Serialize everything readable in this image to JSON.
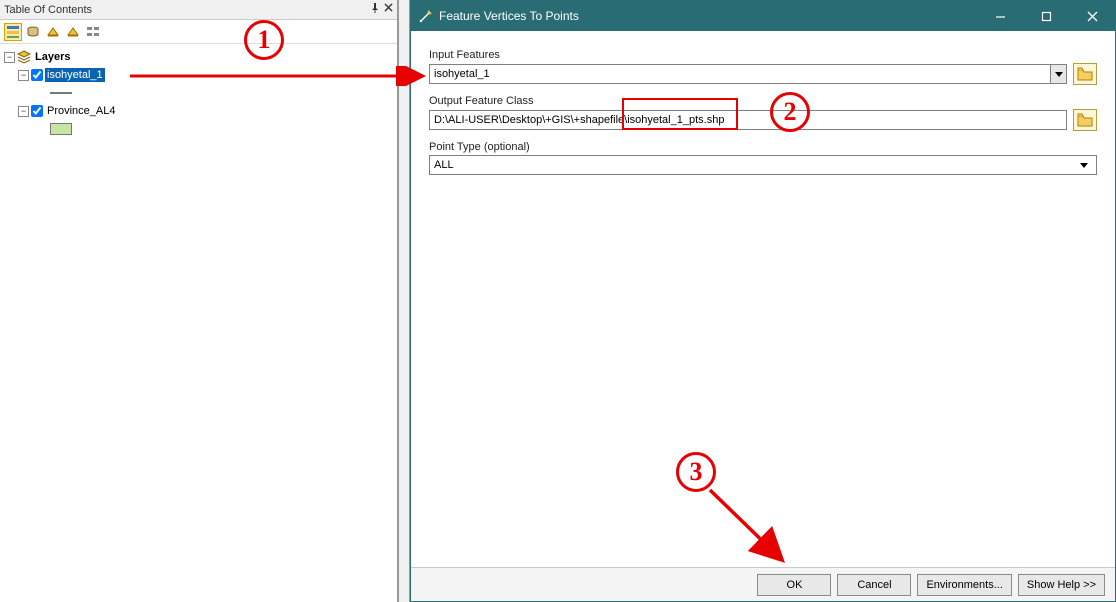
{
  "toc": {
    "title": "Table Of Contents",
    "pin_icon": "pin-icon",
    "close_icon": "close-icon",
    "root_label": "Layers",
    "layers": [
      {
        "name": "isohyetal_1",
        "selected": true
      },
      {
        "name": "Province_AL4",
        "selected": false
      }
    ]
  },
  "dialog": {
    "title": "Feature Vertices To Points",
    "input_features_label": "Input Features",
    "input_features_value": "isohyetal_1",
    "output_label": "Output Feature Class",
    "output_value": "D:\\ALI-USER\\Desktop\\+GIS\\+shapefile\\isohyetal_1_pts.shp",
    "point_type_label": "Point Type (optional)",
    "point_type_value": "ALL",
    "buttons": {
      "ok": "OK",
      "cancel": "Cancel",
      "env": "Environments...",
      "help": "Show Help >>"
    }
  },
  "annotations": {
    "n1": "1",
    "n2": "2",
    "n3": "3"
  }
}
